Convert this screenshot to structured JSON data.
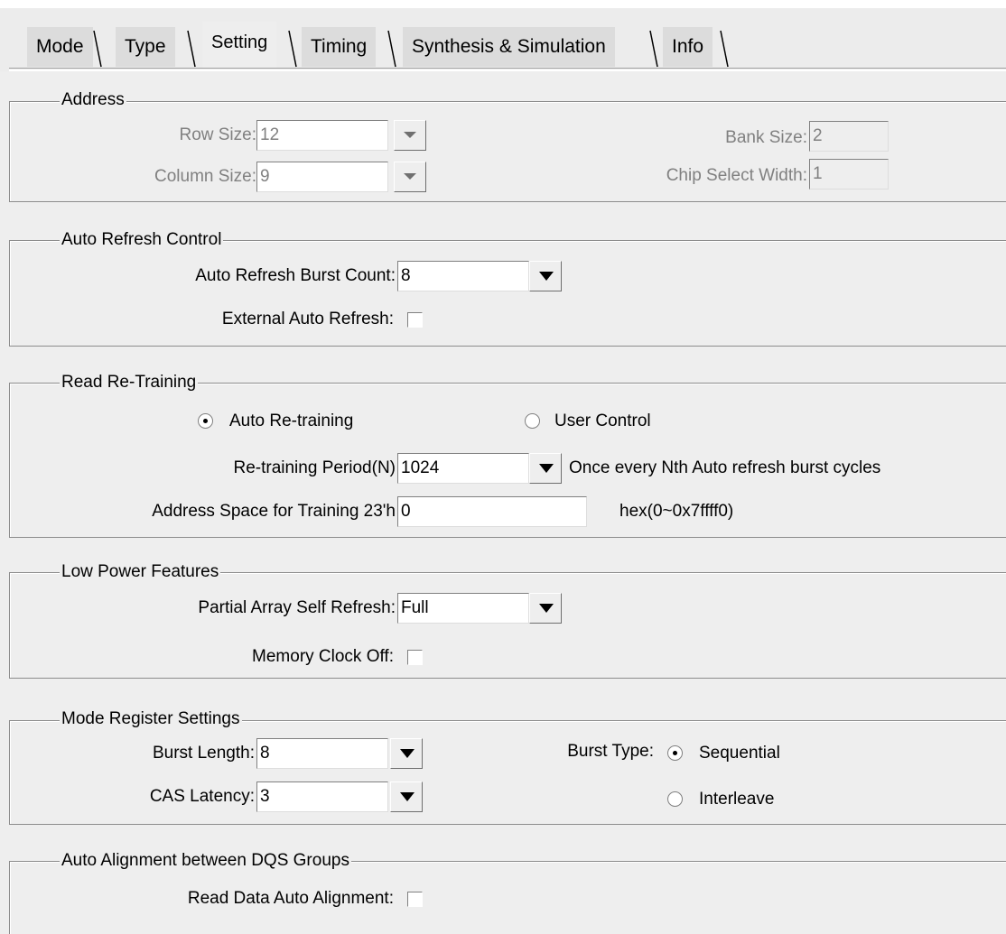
{
  "tabs": [
    {
      "label": "Mode",
      "active": false
    },
    {
      "label": "Type",
      "active": false
    },
    {
      "label": "Setting",
      "active": true
    },
    {
      "label": "Timing",
      "active": false
    },
    {
      "label": "Synthesis & Simulation",
      "active": false
    },
    {
      "label": "Info",
      "active": false
    }
  ],
  "address": {
    "title": "Address",
    "row_size_label": "Row Size:",
    "row_size_value": "12",
    "column_size_label": "Column Size:",
    "column_size_value": "9",
    "bank_size_label": "Bank Size:",
    "bank_size_value": "2",
    "chip_select_label": "Chip Select Width:",
    "chip_select_value": "1"
  },
  "auto_refresh": {
    "title": "Auto Refresh Control",
    "burst_count_label": "Auto Refresh Burst Count:",
    "burst_count_value": "8",
    "external_label": "External Auto Refresh:",
    "external_checked": false
  },
  "retraining": {
    "title": "Read Re-Training",
    "auto_label": "Auto Re-training",
    "user_label": "User Control",
    "selected": "auto",
    "period_label": "Re-training Period(N)",
    "period_value": "1024",
    "period_note": "Once every Nth Auto refresh burst cycles",
    "address_label": "Address Space for Training 23'h",
    "address_value": "0",
    "address_note": "hex(0~0x7ffff0)"
  },
  "low_power": {
    "title": "Low Power Features",
    "pasr_label": "Partial Array Self Refresh:",
    "pasr_value": "Full",
    "clock_off_label": "Memory Clock Off:",
    "clock_off_checked": false
  },
  "mode_register": {
    "title": "Mode Register Settings",
    "burst_length_label": "Burst Length:",
    "burst_length_value": "8",
    "cas_label": "CAS Latency:",
    "cas_value": "3",
    "burst_type_label": "Burst Type:",
    "sequential_label": "Sequential",
    "interleave_label": "Interleave",
    "burst_type_selected": "sequential"
  },
  "auto_alignment": {
    "title": "Auto Alignment between DQS Groups",
    "read_align_label": "Read Data Auto Alignment:",
    "read_align_checked": false
  }
}
